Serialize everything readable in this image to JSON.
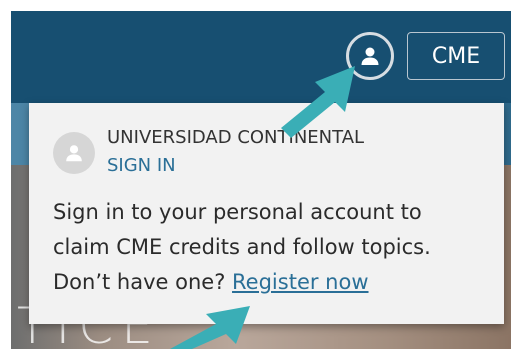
{
  "header": {
    "cme_label": "CME",
    "user_icon": "user-icon",
    "header_color": "#174f71"
  },
  "popover": {
    "institution": "UNIVERSIDAD CONTINENTAL",
    "sign_in": "SIGN IN",
    "message_line1": "Sign in to your personal account to",
    "message_line2": "claim CME credits and follow topics.",
    "message_prefix": "Don’t have one?",
    "register_link": "Register now",
    "link_color": "#2a6f97"
  },
  "hero": {
    "text": "TICE"
  },
  "annotations": {
    "arrow_color": "#3aaeb6"
  }
}
